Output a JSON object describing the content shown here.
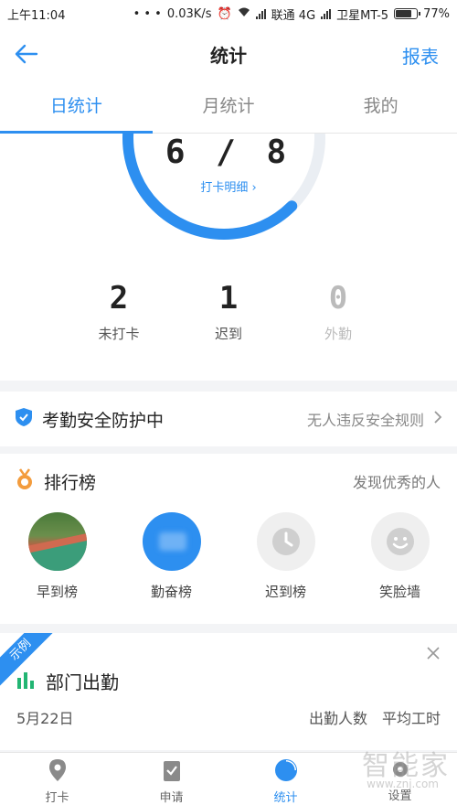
{
  "status_bar": {
    "time": "上午11:04",
    "dots": "• • •",
    "speed": "0.03K/s",
    "carrier1": "联通 4G",
    "carrier2": "卫星MT-5",
    "battery": "77%",
    "battery_level": 0.77
  },
  "nav": {
    "title": "统计",
    "right_label": "报表"
  },
  "tabs": [
    {
      "label": "日统计",
      "active": true
    },
    {
      "label": "月统计",
      "active": false
    },
    {
      "label": "我的",
      "active": false
    }
  ],
  "summary": {
    "ratio": "6 / 8",
    "ratio_fraction": 0.75,
    "detail_link": "打卡明细 ›"
  },
  "counts": [
    {
      "value": "2",
      "label": "未打卡"
    },
    {
      "value": "1",
      "label": "迟到"
    },
    {
      "value": "0",
      "label": "外勤"
    }
  ],
  "security": {
    "title": "考勤安全防护中",
    "desc": "无人违反安全规则"
  },
  "ranking": {
    "title": "排行榜",
    "desc": "发现优秀的人",
    "items": [
      {
        "label": "早到榜",
        "icon": "photo-avatar"
      },
      {
        "label": "勤奋榜",
        "icon": "blue-avatar"
      },
      {
        "label": "迟到榜",
        "icon": "clock-icon"
      },
      {
        "label": "笑脸墙",
        "icon": "smile-icon"
      }
    ]
  },
  "department": {
    "ribbon": "示例",
    "title": "部门出勤",
    "date": "5月22日",
    "col1": "出勤人数",
    "col2": "平均工时"
  },
  "bottom_tabs": [
    {
      "label": "打卡",
      "icon": "location-pin-icon"
    },
    {
      "label": "申请",
      "icon": "clipboard-icon"
    },
    {
      "label": "统计",
      "icon": "pie-chart-icon",
      "active": true
    },
    {
      "label": "设置",
      "icon": "gear-icon"
    }
  ],
  "watermark": {
    "main": "智能家",
    "sub": "www.znj.com"
  },
  "colors": {
    "accent": "#2d8ff0",
    "text": "#222222",
    "muted": "#888888"
  }
}
